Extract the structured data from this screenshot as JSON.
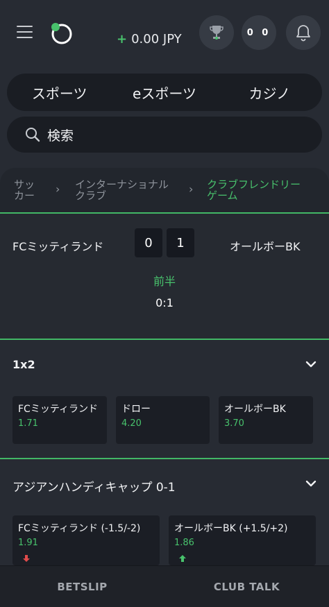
{
  "header": {
    "balance_sign": "+",
    "balance": "0.00 JPY",
    "score_badge": "0 0"
  },
  "nav_tabs": [
    "スポーツ",
    "eスポーツ",
    "カジノ"
  ],
  "search": {
    "placeholder": "検索"
  },
  "breadcrumb": {
    "items": [
      {
        "line1": "サッ",
        "line2": "カー"
      },
      {
        "line1": "インターナショナル",
        "line2": "クラブ"
      },
      {
        "line1": "クラブフレンドリー",
        "line2": "ゲーム"
      }
    ]
  },
  "match": {
    "home": "FCミッティランド",
    "away": "オールボーBK",
    "home_score": "0",
    "away_score": "1",
    "period": "前半",
    "score_text": "0:1"
  },
  "markets": [
    {
      "title": "1x2",
      "odds": [
        {
          "label": "FCミッティランド",
          "value": "1.71"
        },
        {
          "label": "ドロー",
          "value": "4.20"
        },
        {
          "label": "オールボーBK",
          "value": "3.70"
        }
      ]
    },
    {
      "title": "アジアンハンディキャップ 0-1",
      "odds": [
        {
          "label": "FCミッティランド (-1.5/-2)",
          "value": "1.91",
          "trend": "down"
        },
        {
          "label": "オールボーBK (+1.5/+2)",
          "value": "1.86",
          "trend": "up"
        }
      ]
    }
  ],
  "bottom_bar": {
    "betslip": "BETSLIP",
    "club_talk": "CLUB TALK"
  },
  "colors": {
    "accent": "#48c26c",
    "down": "#e04b4b",
    "background": "#272b33"
  }
}
